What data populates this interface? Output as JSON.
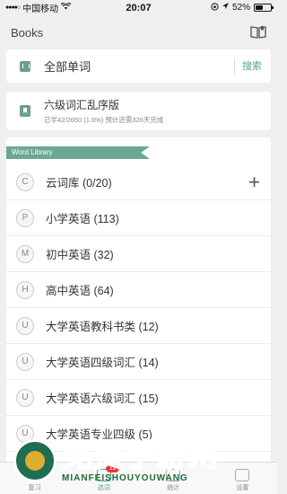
{
  "status_bar": {
    "carrier": "中国移动",
    "time": "20:07",
    "battery_percent": "52%",
    "battery_level": 0.52
  },
  "header": {
    "title": "Books",
    "icon": "open-book-icon"
  },
  "all_words": {
    "label": "全部单词",
    "search_label": "搜索",
    "icon": "book-icon"
  },
  "plan": {
    "name": "六级词汇乱序版",
    "progress_text": "已学42/2650 (1.6%)  预计还需326天完成",
    "icon": "bookmark-icon"
  },
  "library": {
    "ribbon_label": "Word Library",
    "items": [
      {
        "letter": "C",
        "sub": "",
        "label": "云词库 (0/20)",
        "has_add": true
      },
      {
        "letter": "P",
        "sub": "",
        "label": "小学英语 (113)"
      },
      {
        "letter": "M",
        "sub": "",
        "label": "初中英语 (32)"
      },
      {
        "letter": "H",
        "sub": "",
        "label": "高中英语 (64)"
      },
      {
        "letter": "U",
        "sub": "",
        "label": "大学英语教科书类 (12)"
      },
      {
        "letter": "U",
        "sub": "4",
        "label": "大学英语四级词汇 (14)"
      },
      {
        "letter": "U",
        "sub": "6",
        "label": "大学英语六级词汇 (15)"
      },
      {
        "letter": "U",
        "sub": "",
        "label": "大学英语专业四级 (5)"
      }
    ],
    "add_symbol": "+"
  },
  "tabbar": {
    "tabs": [
      {
        "label": "复习",
        "icon": "review-icon"
      },
      {
        "label": "选词",
        "icon": "select-words-icon",
        "badge": "11",
        "active": true
      },
      {
        "label": "统计",
        "icon": "stats-icon"
      },
      {
        "label": "设置",
        "icon": "settings-icon"
      }
    ]
  },
  "watermark": {
    "big": "免费手游网",
    "small": "MIANFEISHOUYOUWANG"
  },
  "colors": {
    "accent": "#5aa48b",
    "ribbon": "#6aa893",
    "background": "#efefef"
  }
}
